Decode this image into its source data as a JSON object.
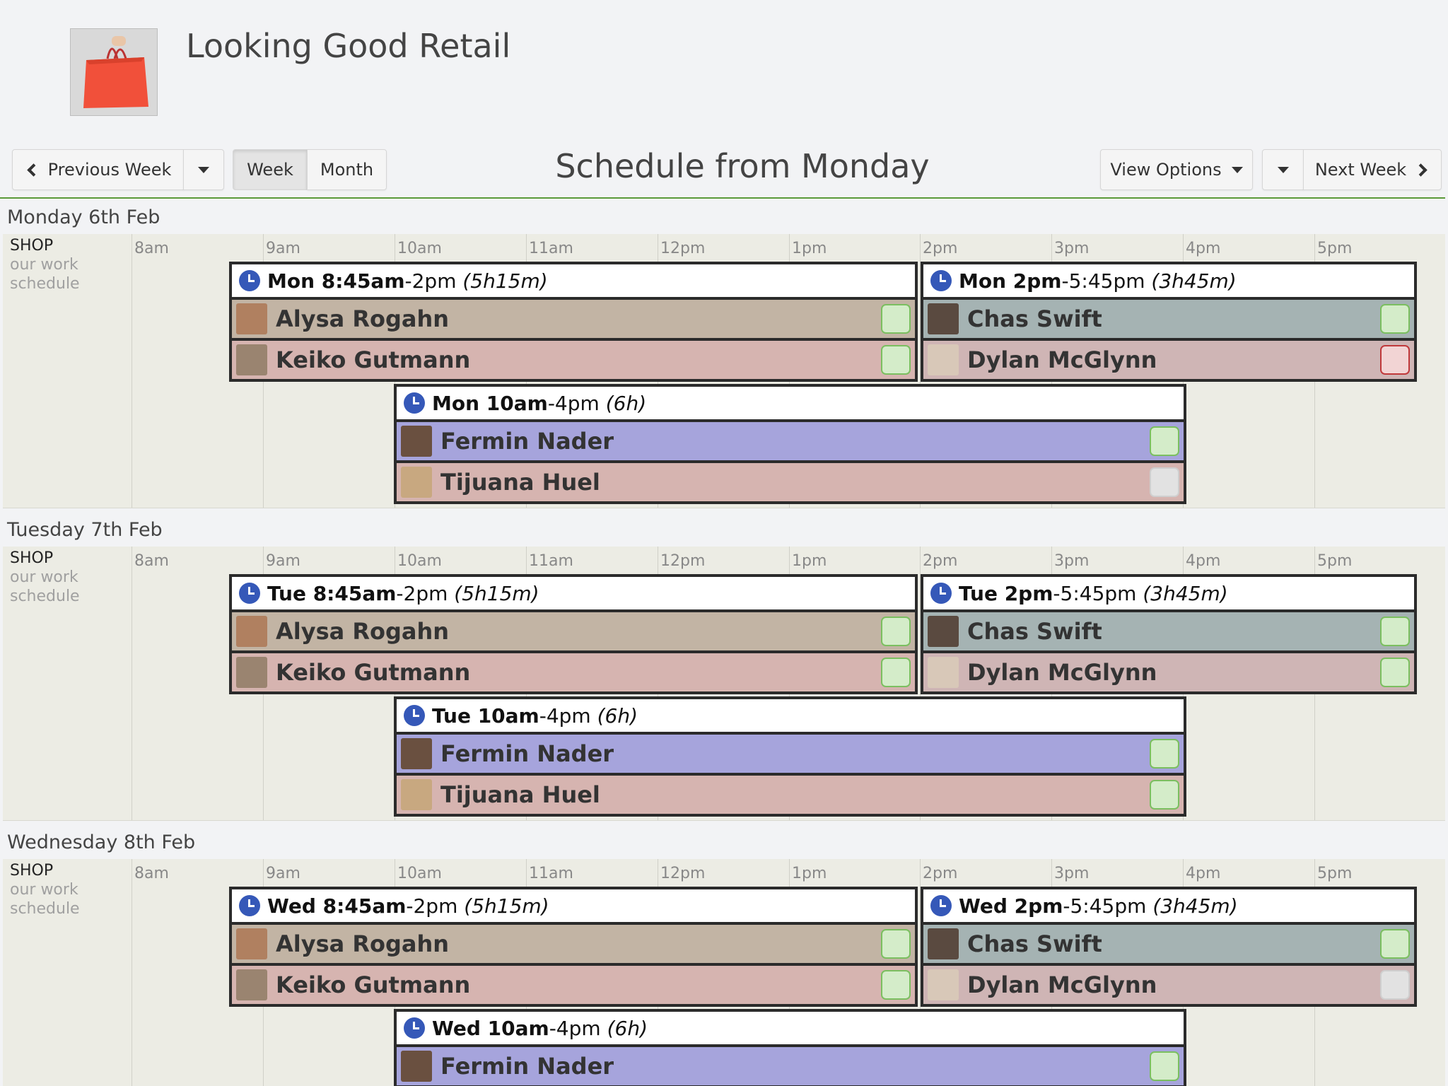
{
  "header": {
    "title": "Looking Good Retail"
  },
  "toolbar": {
    "prev_label": "Previous Week",
    "week_label": "Week",
    "month_label": "Month",
    "schedule_title": "Schedule from Monday",
    "view_options_label": "View Options",
    "next_label": "Next Week"
  },
  "hours": [
    "8am",
    "9am",
    "10am",
    "11am",
    "12pm",
    "1pm",
    "2pm",
    "3pm",
    "4pm",
    "5pm"
  ],
  "location": {
    "name": "SHOP",
    "sub": "our work schedule"
  },
  "days": [
    {
      "label": "Monday 6th Feb",
      "shifts": [
        {
          "start": "Mon 8:45am",
          "end": "-2pm",
          "dur": "(5h15m)",
          "people": [
            {
              "name": "Alysa Rogahn",
              "color": "#c2b4a4",
              "status": "green"
            },
            {
              "name": "Keiko Gutmann",
              "color": "#d6b4b0",
              "status": "green"
            }
          ]
        },
        {
          "start": "Mon 2pm",
          "end": "-5:45pm",
          "dur": "(3h45m)",
          "people": [
            {
              "name": "Chas Swift",
              "color": "#a5b3b3",
              "status": "green"
            },
            {
              "name": "Dylan McGlynn",
              "color": "#cfb5b5",
              "status": "red"
            }
          ]
        },
        {
          "start": "Mon 10am",
          "end": "-4pm",
          "dur": "(6h)",
          "people": [
            {
              "name": "Fermin Nader",
              "color": "#a6a4dc",
              "status": "green"
            },
            {
              "name": "Tijuana Huel",
              "color": "#d6b4b0",
              "status": "gray"
            }
          ]
        }
      ]
    },
    {
      "label": "Tuesday 7th Feb",
      "shifts": [
        {
          "start": "Tue 8:45am",
          "end": "-2pm",
          "dur": "(5h15m)",
          "people": [
            {
              "name": "Alysa Rogahn",
              "color": "#c2b4a4",
              "status": "green"
            },
            {
              "name": "Keiko Gutmann",
              "color": "#d6b4b0",
              "status": "green"
            }
          ]
        },
        {
          "start": "Tue 2pm",
          "end": "-5:45pm",
          "dur": "(3h45m)",
          "people": [
            {
              "name": "Chas Swift",
              "color": "#a5b3b3",
              "status": "green"
            },
            {
              "name": "Dylan McGlynn",
              "color": "#cfb5b5",
              "status": "green"
            }
          ]
        },
        {
          "start": "Tue 10am",
          "end": "-4pm",
          "dur": "(6h)",
          "people": [
            {
              "name": "Fermin Nader",
              "color": "#a6a4dc",
              "status": "green"
            },
            {
              "name": "Tijuana Huel",
              "color": "#d6b4b0",
              "status": "green"
            }
          ]
        }
      ]
    },
    {
      "label": "Wednesday 8th Feb",
      "shifts": [
        {
          "start": "Wed 8:45am",
          "end": "-2pm",
          "dur": "(5h15m)",
          "people": [
            {
              "name": "Alysa Rogahn",
              "color": "#c2b4a4",
              "status": "green"
            },
            {
              "name": "Keiko Gutmann",
              "color": "#d6b4b0",
              "status": "green"
            }
          ]
        },
        {
          "start": "Wed 2pm",
          "end": "-5:45pm",
          "dur": "(3h45m)",
          "people": [
            {
              "name": "Chas Swift",
              "color": "#a5b3b3",
              "status": "green"
            },
            {
              "name": "Dylan McGlynn",
              "color": "#cfb5b5",
              "status": "gray"
            }
          ]
        },
        {
          "start": "Wed 10am",
          "end": "-4pm",
          "dur": "(6h)",
          "people": [
            {
              "name": "Fermin Nader",
              "color": "#a6a4dc",
              "status": "green"
            }
          ]
        }
      ]
    }
  ]
}
